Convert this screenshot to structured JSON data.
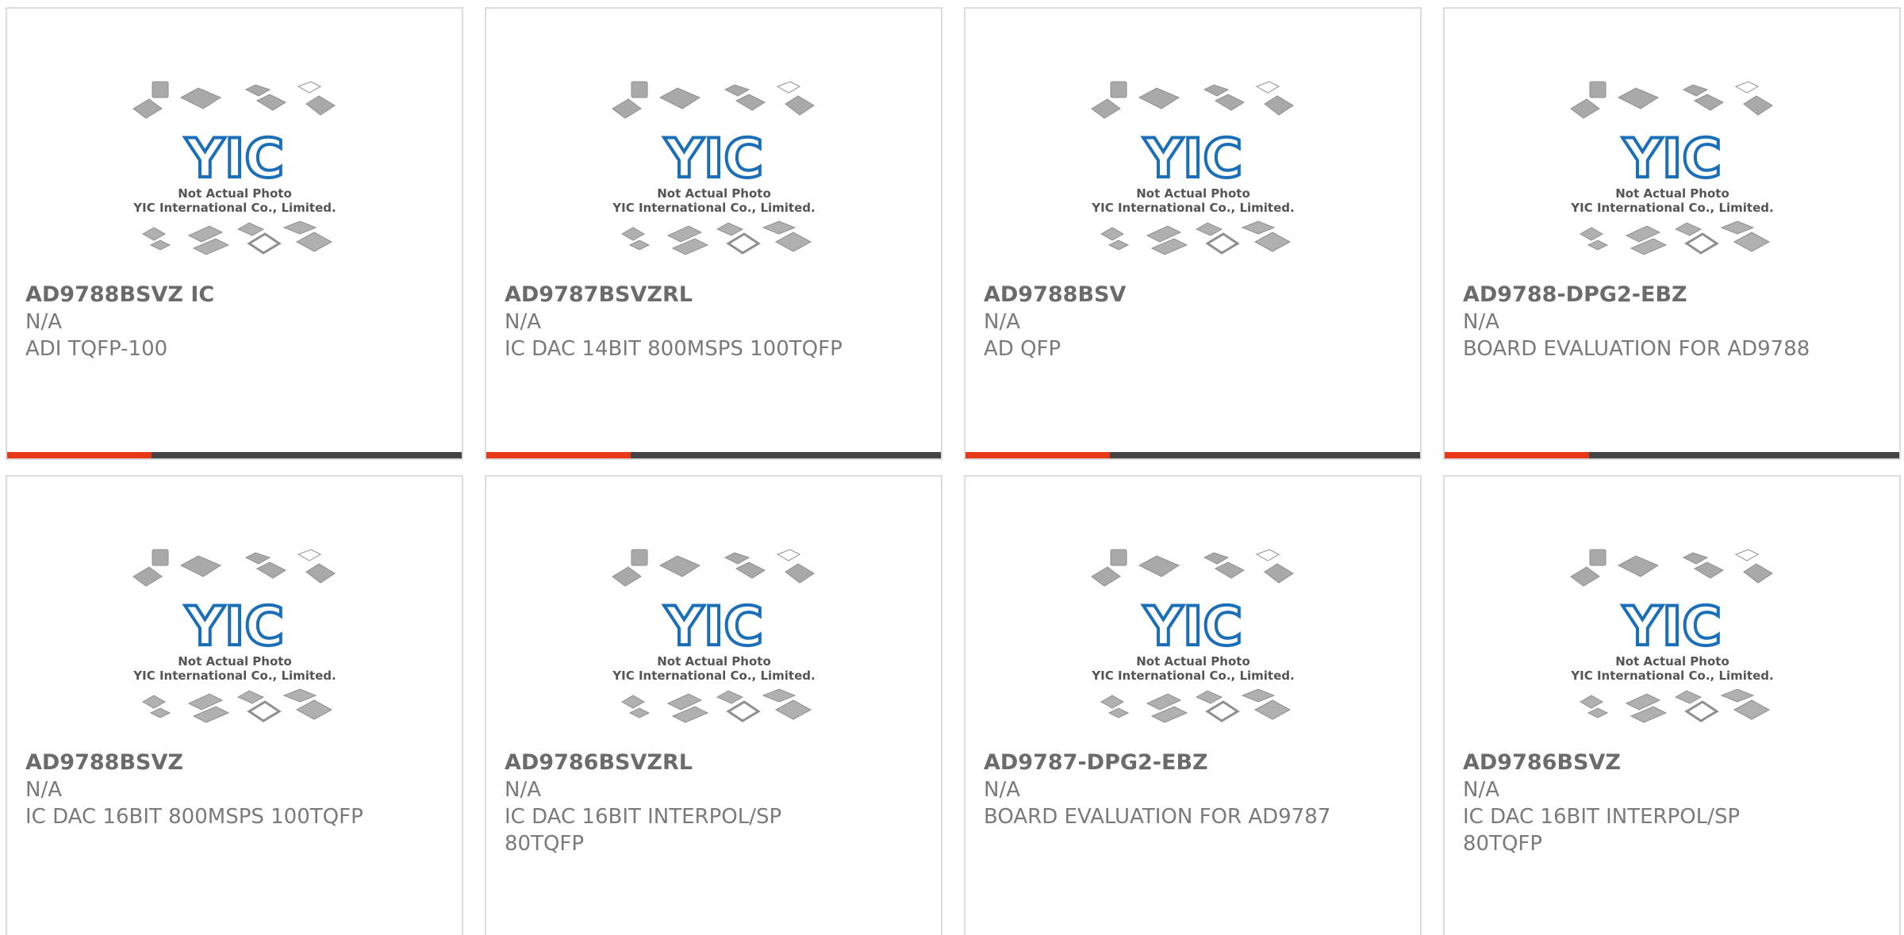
{
  "products": [
    {
      "part": "AD9788BSVZ IC",
      "stock": "N/A",
      "desc": "ADI TQFP-100"
    },
    {
      "part": "AD9787BSVZRL",
      "stock": "N/A",
      "desc": "IC DAC 14BIT 800MSPS 100TQFP"
    },
    {
      "part": "AD9788BSV",
      "stock": "N/A",
      "desc": "AD QFP"
    },
    {
      "part": "AD9788-DPG2-EBZ",
      "stock": "N/A",
      "desc": "BOARD EVALUATION FOR AD9788"
    },
    {
      "part": "AD9788BSVZ",
      "stock": "N/A",
      "desc": "IC DAC 16BIT 800MSPS 100TQFP"
    },
    {
      "part": "AD9786BSVZRL",
      "stock": "N/A",
      "desc": "IC DAC 16BIT INTERPOL/SP 80TQFP"
    },
    {
      "part": "AD9787-DPG2-EBZ",
      "stock": "N/A",
      "desc": "BOARD EVALUATION FOR AD9787"
    },
    {
      "part": "AD9786BSVZ",
      "stock": "N/A",
      "desc": "IC DAC 16BIT INTERPOL/SP 80TQFP"
    }
  ],
  "placeholder": {
    "logo_text": "YIC",
    "line1": "Not Actual Photo",
    "line2": "YIC International Co., Limited."
  },
  "colors": {
    "accent": "#e8381a",
    "bar": "#444444",
    "logo": "#1a6fb8"
  }
}
